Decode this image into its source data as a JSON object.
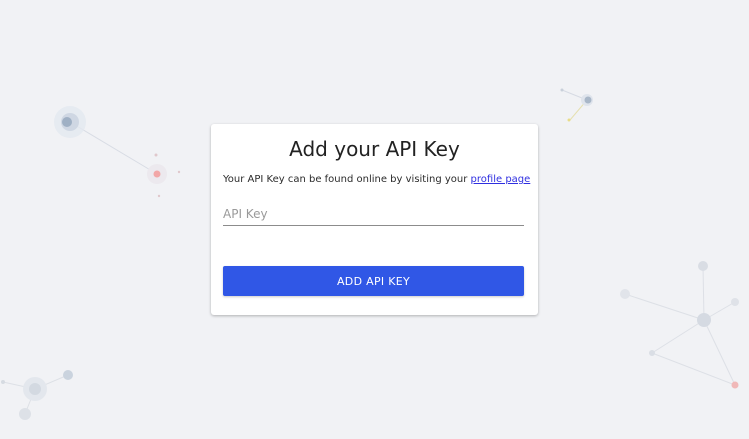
{
  "card": {
    "title": "Add your API Key",
    "description_prefix": "Your API Key can be found online by visiting your",
    "description_link": "profile page",
    "input_placeholder": "API Key",
    "input_value": "",
    "button_label": "ADD API KEY"
  },
  "colors": {
    "background": "#f1f2f5",
    "card": "#ffffff",
    "button": "#3057e6",
    "link": "#2f2fe0"
  }
}
